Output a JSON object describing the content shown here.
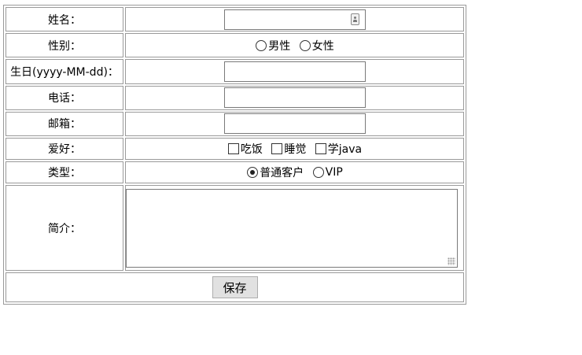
{
  "form": {
    "name": {
      "label": "姓名：",
      "value": ""
    },
    "gender": {
      "label": "性别：",
      "options": [
        "男性",
        "女性"
      ]
    },
    "birthday": {
      "label": "生日(yyyy-MM-dd)：",
      "value": ""
    },
    "phone": {
      "label": "电话：",
      "value": ""
    },
    "email": {
      "label": "邮箱：",
      "value": ""
    },
    "hobbies": {
      "label": "爱好：",
      "options": [
        "吃饭",
        "睡觉",
        "学java"
      ]
    },
    "type": {
      "label": "类型：",
      "options": [
        "普通客户",
        "VIP"
      ],
      "selected": "普通客户"
    },
    "intro": {
      "label": "简介：",
      "value": ""
    },
    "save_label": "保存"
  }
}
